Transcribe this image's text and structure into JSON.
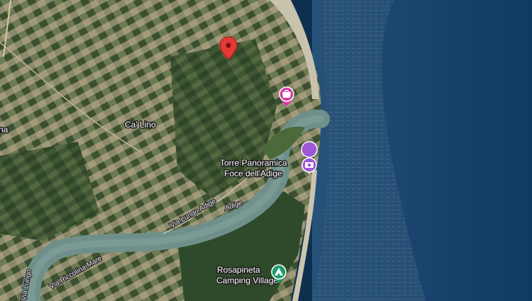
{
  "map": {
    "type": "satellite",
    "places": {
      "ca_lino": "Ca' Lino",
      "edge_fragment": "na"
    },
    "pois": [
      {
        "name_line1": "Torre Panoramica",
        "name_line2": "Foce dell'Adige",
        "icon": "camera-icon",
        "color": "#9c58d6"
      },
      {
        "name_line1": "Rosapineta",
        "name_line2": "Camping Village",
        "icon": "tent-icon",
        "color": "#1e9e6a"
      },
      {
        "name_line1": "",
        "icon": "shopping-icon",
        "color": "#d43ea3"
      }
    ],
    "rivers": {
      "adige": "Adige"
    },
    "roads": {
      "via_lungo_adige": "Via Lungo Adige",
      "via_riccoline_mare": "Via Riccolina Mare",
      "via_lungo_left": "Via Lungo"
    },
    "marker": {
      "icon": "location-pin-icon",
      "color": "#e53935"
    }
  }
}
